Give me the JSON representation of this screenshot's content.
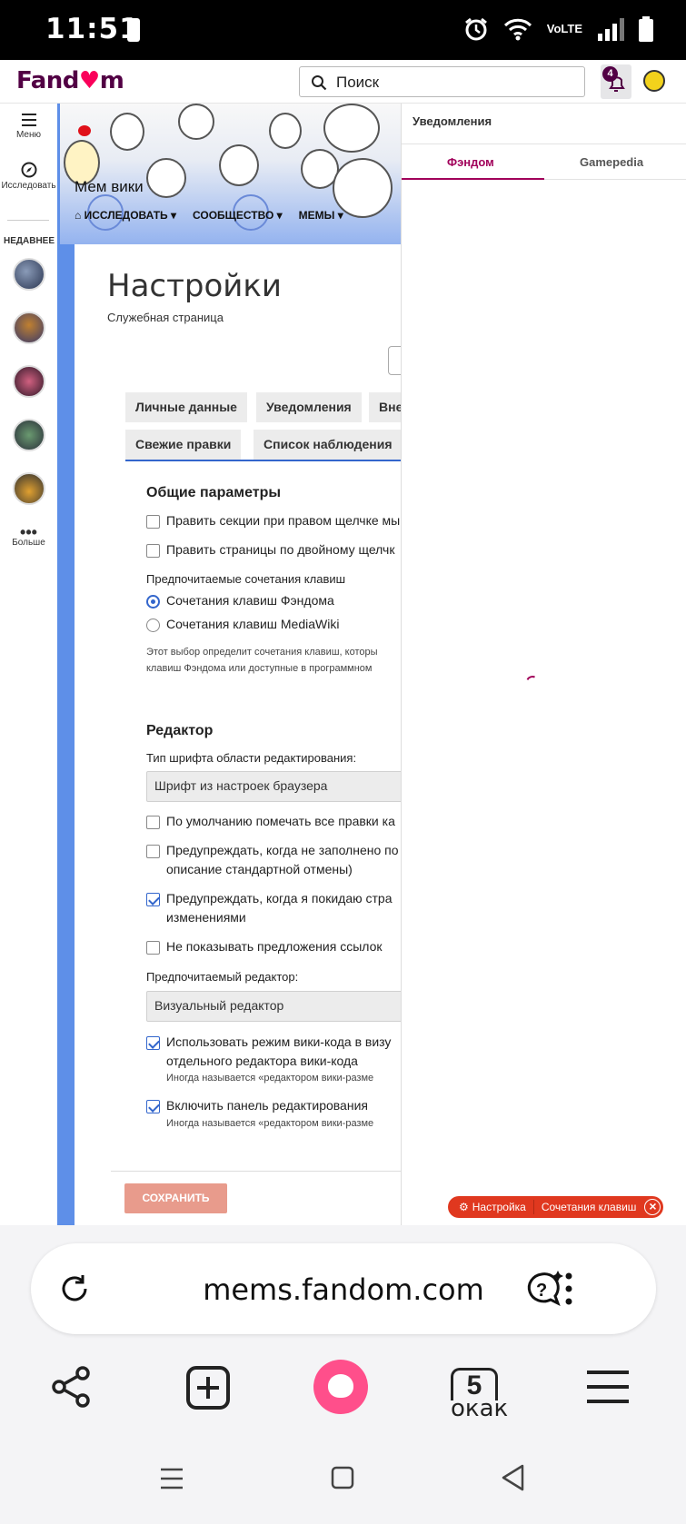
{
  "status_bar": {
    "time": "11:51",
    "network": "VoLTE"
  },
  "header": {
    "logo": "Fandom",
    "search_placeholder": "Поиск",
    "notifications_count": "4"
  },
  "rail": {
    "menu_label": "Меню",
    "explore_label": "Исследовать",
    "recent_label": "НЕДАВНЕЕ",
    "more_label": "Больше"
  },
  "wiki": {
    "title": "Мем вики",
    "nav": [
      "ИССЛЕДОВАТЬ",
      "СООБЩЕСТВО",
      "МЕМЫ"
    ]
  },
  "page": {
    "title": "Настройки",
    "subtitle": "Служебная страница",
    "tabs_row1": [
      "Личные данные",
      "Уведомления",
      "Вне"
    ],
    "tabs_row2": [
      "Свежие правки",
      "Список наблюдения"
    ],
    "general": {
      "heading": "Общие параметры",
      "opt_edit_section_right_click": "Править секции при правом щелчке мы",
      "opt_edit_double_click": "Править страницы по двойному щелчк",
      "shortcuts_label": "Предпочитаемые сочетания клавиш",
      "shortcut_fandom": "Сочетания клавиш Фэндома",
      "shortcut_mediawiki": "Сочетания клавиш MediaWiki",
      "help_line1": "Этот выбор определит сочетания клавиш, которы",
      "help_line2": "клавиш Фэндома или доступные в программном"
    },
    "editor": {
      "heading": "Редактор",
      "font_label": "Тип шрифта области редактирования:",
      "font_value": "Шрифт из настроек браузера",
      "opt_minor": "По умолчанию помечать все правки ка",
      "opt_warn_summary_1": "Предупреждать, когда не заполнено по",
      "opt_warn_summary_2": "описание стандартной отмены)",
      "opt_warn_leave_1": "Предупреждать, когда я покидаю стра",
      "opt_warn_leave_2": "изменениями",
      "opt_no_link_suggest": "Не показывать предложения ссылок",
      "preferred_editor_label": "Предпочитаемый редактор:",
      "preferred_editor_value": "Визуальный редактор",
      "opt_wikitext_1": "Использовать режим вики-кода в визу",
      "opt_wikitext_2": "отдельного редактора вики-кода",
      "opt_wikitext_hint": "Иногда называется «редактором вики-разме",
      "opt_toolbar": "Включить панель редактирования",
      "opt_toolbar_hint": "Иногда называется «редактором вики-разме"
    },
    "save_label": "СОХРАНИТЬ"
  },
  "notifications": {
    "title": "Уведомления",
    "tab_fandom": "Фэндом",
    "tab_gamepedia": "Gamepedia"
  },
  "toolbar_pill": {
    "settings": "Настройка",
    "shortcuts": "Сочетания клавиш"
  },
  "browser": {
    "url": "mems.fandom.com",
    "tabs_count": "5",
    "tabs_word": "окак"
  },
  "colors": {
    "fandom_purple": "#520044",
    "fandom_pink": "#fa005a",
    "link_blue": "#3366cc",
    "save_button": "#e89b8c",
    "pill_red": "#e0381f",
    "wiki_accent": "#5e8fe8"
  }
}
